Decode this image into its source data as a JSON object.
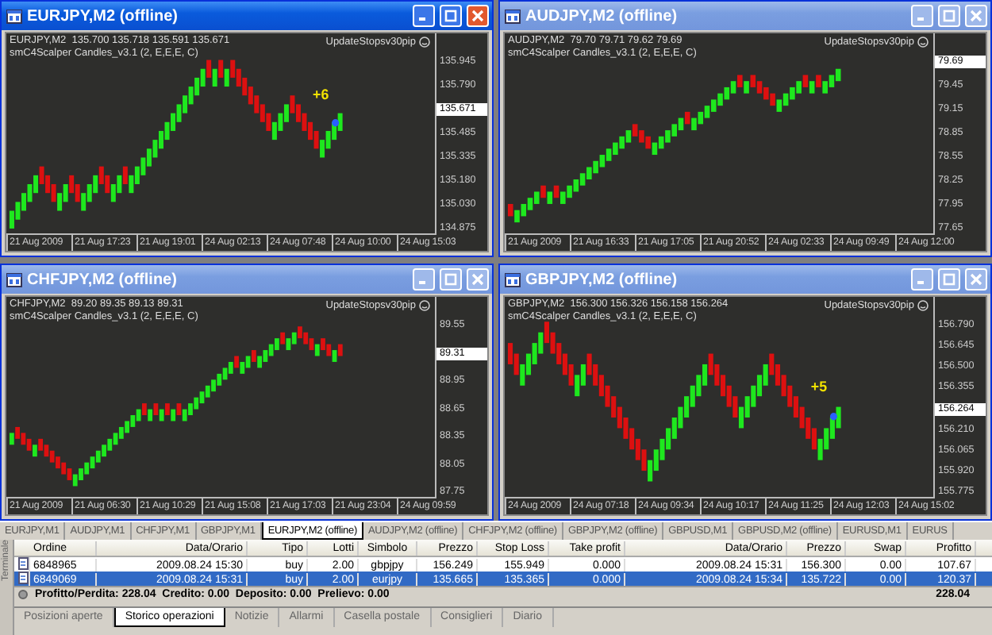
{
  "windows": [
    {
      "title": "EURJPY,M2 (offline)",
      "active": true,
      "quote": "EURJPY,M2  135.700 135.718 135.591 135.671",
      "indicator": "smC4Scalper Candles_v3.1 (2, E,E,E, C)",
      "expert": "UpdateStopsv30pip",
      "marker": "+6",
      "yticks": [
        {
          "label": "135.945",
          "kind": "tick"
        },
        {
          "label": "135.790",
          "kind": "tick"
        },
        {
          "label": "135.671",
          "kind": "current"
        },
        {
          "label": "135.485",
          "kind": "tick"
        },
        {
          "label": "135.335",
          "kind": "tick"
        },
        {
          "label": "135.180",
          "kind": "tick"
        },
        {
          "label": "135.030",
          "kind": "tick"
        },
        {
          "label": "134.875",
          "kind": "tick"
        }
      ],
      "xticks": [
        "21 Aug 2009",
        "21 Aug 17:23",
        "21 Aug 19:01",
        "24 Aug 02:13",
        "24 Aug 07:48",
        "24 Aug 10:00",
        "24 Aug 15:03"
      ]
    },
    {
      "title": "AUDJPY,M2 (offline)",
      "active": false,
      "quote": "AUDJPY,M2  79.70 79.71 79.62 79.69",
      "indicator": "smC4Scalper Candles_v3.1 (2, E,E,E, C)",
      "expert": "UpdateStopsv30pip",
      "yticks": [
        {
          "label": "79.69",
          "kind": "current"
        },
        {
          "label": "79.45",
          "kind": "tick"
        },
        {
          "label": "79.15",
          "kind": "tick"
        },
        {
          "label": "78.85",
          "kind": "tick"
        },
        {
          "label": "78.55",
          "kind": "tick"
        },
        {
          "label": "78.25",
          "kind": "tick"
        },
        {
          "label": "77.95",
          "kind": "tick"
        },
        {
          "label": "77.65",
          "kind": "tick"
        }
      ],
      "xticks": [
        "21 Aug 2009",
        "21 Aug 16:33",
        "21 Aug 17:05",
        "21 Aug 20:52",
        "24 Aug 02:33",
        "24 Aug 09:49",
        "24 Aug 12:00"
      ]
    },
    {
      "title": "CHFJPY,M2 (offline)",
      "active": false,
      "quote": "CHFJPY,M2  89.20 89.35 89.13 89.31",
      "indicator": "smC4Scalper Candles_v3.1 (2, E,E,E, C)",
      "expert": "UpdateStopsv30pip",
      "yticks": [
        {
          "label": "89.55",
          "kind": "tick"
        },
        {
          "label": "89.31",
          "kind": "current"
        },
        {
          "label": "88.95",
          "kind": "tick"
        },
        {
          "label": "88.65",
          "kind": "tick"
        },
        {
          "label": "88.35",
          "kind": "tick"
        },
        {
          "label": "88.05",
          "kind": "tick"
        },
        {
          "label": "87.75",
          "kind": "tick"
        }
      ],
      "xticks": [
        "21 Aug 2009",
        "21 Aug 06:30",
        "21 Aug 10:29",
        "21 Aug 15:08",
        "21 Aug 17:03",
        "21 Aug 23:04",
        "24 Aug 09:59"
      ]
    },
    {
      "title": "GBPJPY,M2 (offline)",
      "active": false,
      "quote": "GBPJPY,M2  156.300 156.326 156.158 156.264",
      "indicator": "smC4Scalper Candles_v3.1 (2, E,E,E, C)",
      "expert": "UpdateStopsv30pip",
      "marker": "+5",
      "yticks": [
        {
          "label": "156.790",
          "kind": "tick"
        },
        {
          "label": "156.645",
          "kind": "tick"
        },
        {
          "label": "156.500",
          "kind": "tick"
        },
        {
          "label": "156.355",
          "kind": "tick"
        },
        {
          "label": "156.264",
          "kind": "current"
        },
        {
          "label": "156.210",
          "kind": "tick"
        },
        {
          "label": "156.065",
          "kind": "tick"
        },
        {
          "label": "155.920",
          "kind": "tick"
        },
        {
          "label": "155.775",
          "kind": "tick"
        }
      ],
      "xticks": [
        "24 Aug 2009",
        "24 Aug 07:18",
        "24 Aug 09:34",
        "24 Aug 10:17",
        "24 Aug 11:25",
        "24 Aug 12:03",
        "24 Aug 15:02"
      ]
    }
  ],
  "chart_tabs": [
    {
      "label": "EURJPY,M1",
      "selected": false
    },
    {
      "label": "AUDJPY,M1",
      "selected": false
    },
    {
      "label": "CHFJPY,M1",
      "selected": false
    },
    {
      "label": "GBPJPY,M1",
      "selected": false
    },
    {
      "label": "EURJPY,M2 (offline)",
      "selected": true
    },
    {
      "label": "AUDJPY,M2 (offline)",
      "selected": false
    },
    {
      "label": "CHFJPY,M2 (offline)",
      "selected": false
    },
    {
      "label": "GBPJPY,M2 (offline)",
      "selected": false
    },
    {
      "label": "GBPUSD,M1",
      "selected": false
    },
    {
      "label": "GBPUSD,M2 (offline)",
      "selected": false
    },
    {
      "label": "EURUSD,M1",
      "selected": false
    },
    {
      "label": "EURUS",
      "selected": false
    }
  ],
  "terminal": {
    "title": "Terminale",
    "columns": [
      "Ordine",
      "Data/Orario",
      "Tipo",
      "Lotti",
      "Simbolo",
      "Prezzo",
      "Stop Loss",
      "Take profit",
      "Data/Orario",
      "Prezzo",
      "Swap",
      "Profitto"
    ],
    "rows": [
      {
        "selected": false,
        "cells": [
          "6848965",
          "2009.08.24 15:30",
          "buy",
          "2.00",
          "gbpjpy",
          "156.249",
          "155.949",
          "0.000",
          "2009.08.24 15:31",
          "156.300",
          "0.00",
          "107.67"
        ]
      },
      {
        "selected": true,
        "cells": [
          "6849069",
          "2009.08.24 15:31",
          "buy",
          "2.00",
          "eurjpy",
          "135.665",
          "135.365",
          "0.000",
          "2009.08.24 15:34",
          "135.722",
          "0.00",
          "120.37"
        ]
      }
    ],
    "summary": "Profitto/Perdita: 228.04  Credito: 0.00  Deposito: 0.00  Prelievo: 0.00",
    "total": "228.04",
    "tabs": [
      {
        "label": "Posizioni aperte",
        "selected": false
      },
      {
        "label": "Storico operazioni",
        "selected": true
      },
      {
        "label": "Notizie",
        "selected": false
      },
      {
        "label": "Allarmi",
        "selected": false
      },
      {
        "label": "Casella postale",
        "selected": false
      },
      {
        "label": "Consiglieri",
        "selected": false
      },
      {
        "label": "Diario",
        "selected": false
      }
    ]
  }
}
